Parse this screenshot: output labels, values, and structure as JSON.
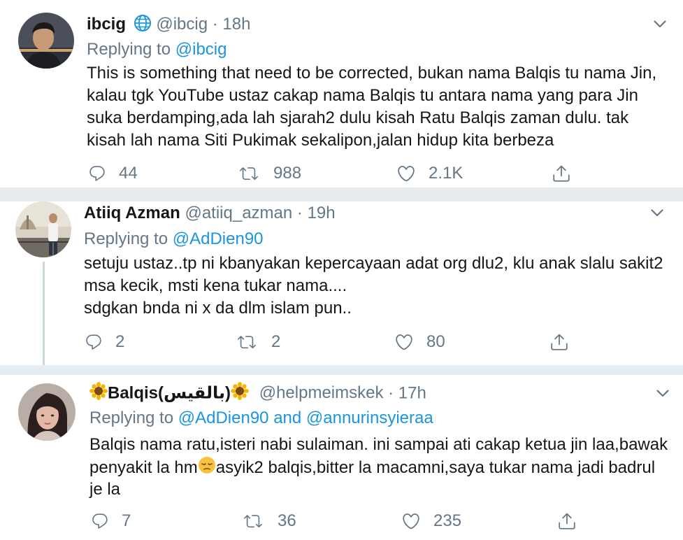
{
  "tweets": [
    {
      "name": "ibcig",
      "handle": "@ibcig",
      "time": "· 18h",
      "replying_prefix": "Replying to ",
      "replying_to": "@ibcig",
      "lines": [
        "This is something that need to be corrected, bukan nama Balqis tu nama Jin,",
        "kalau tgk YouTube ustaz cakap nama Balqis tu antara nama yang para Jin",
        "suka berdamping,ada lah sjarah2 dulu kisah Ratu Balqis zaman dulu. tak",
        "kisah lah nama Siti Pukimak sekalipon,jalan hidup kita berbeza"
      ],
      "replies": "44",
      "retweets": "988",
      "likes": "2.1K"
    },
    {
      "name": "Atiiq Azman",
      "handle": "@atiiq_azman",
      "time": "· 19h",
      "replying_prefix": "Replying to ",
      "replying_to": "@AdDien90",
      "lines": [
        "setuju ustaz..tp ni kbanyakan kepercayaan adat org dlu2, klu anak slalu sakit2",
        "msa kecik, msti kena tukar nama....",
        "sdgkan bnda ni x da dlm islam pun.."
      ],
      "replies": "2",
      "retweets": "2",
      "likes": "80"
    },
    {
      "name": "Balqis(بالقيس)",
      "handle": "@helpmeimskek",
      "time": "· 17h",
      "replying_prefix": "Replying to ",
      "replying_to": "@AdDien90 and @annurinsyieraa",
      "lines": [
        "Balqis nama ratu,isteri nabi sulaiman. ini sampai ati cakap ketua jin laa,bawak",
        "penyakit la hm",
        "asyik2 balqis,bitter la macamni,saya tukar nama jadi badrul",
        "je la"
      ],
      "replies": "7",
      "retweets": "36",
      "likes": "235"
    }
  ],
  "icons": {
    "verified": "globe-icon",
    "name_emoji": "sunflower-emoji",
    "inline_emoji": "pensive-face-emoji"
  },
  "colors": {
    "link": "#1b95e0",
    "muted": "#657786",
    "text": "#14171a",
    "divider": "#e6ecf0",
    "thread_line": "#ccd6dd"
  }
}
